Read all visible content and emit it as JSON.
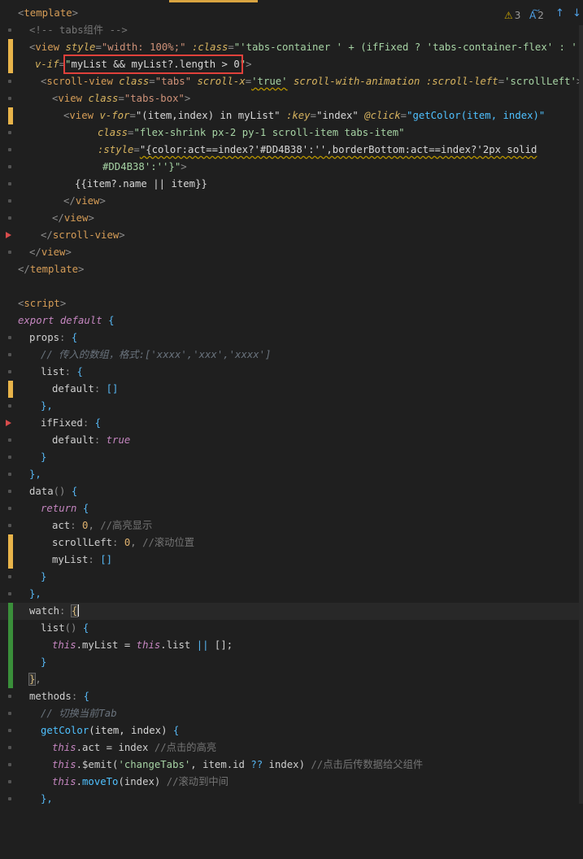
{
  "header": {
    "warning_count": "3",
    "info_count": "2"
  },
  "icons": [
    "warning-icon",
    "spell-icon",
    "arrow-up-icon",
    "arrow-down-icon"
  ],
  "colors": {
    "background": "#1f1f1f",
    "modified_marker": "#e8b44a",
    "added_marker": "#3a8f3a",
    "highlight_box": "#e0413b"
  },
  "code": {
    "l1": {
      "t1": "<",
      "t2": "template",
      "t3": ">"
    },
    "l2": {
      "t1": "<!-- tabs组件 -->"
    },
    "l3": {
      "t1": "<",
      "t2": "view",
      "t3": " ",
      "t4": "style",
      "t5": "=",
      "t6": "\"width: 100%;\"",
      "t7": " ",
      "t8": ":class",
      "t9": "=",
      "t10": "\"'tabs-container ' + (ifFixed ? 'tabs-container-flex' : '')\""
    },
    "l4": {
      "t1": "v-if",
      "t2": "=",
      "t3": "\"",
      "t4": "myList && myList?.length > 0",
      "t5": "\"",
      "t6": ">"
    },
    "l5": {
      "t1": "<",
      "t2": "scroll-view",
      "t3": " ",
      "t4": "class",
      "t5": "=",
      "t6": "\"tabs\"",
      "t7": " ",
      "t8": "scroll-x",
      "t9": "=",
      "t10": "'true'",
      "t11": " ",
      "t12": "scroll-with-animation",
      "t13": " ",
      "t14": ":scroll-left",
      "t15": "=",
      "t16": "'scrollLeft'",
      "t17": ">"
    },
    "l6": {
      "t1": "<",
      "t2": "view",
      "t3": " ",
      "t4": "class",
      "t5": "=",
      "t6": "\"tabs-box\"",
      "t7": ">"
    },
    "l7": {
      "t1": "<",
      "t2": "view",
      "t3": " ",
      "t4": "v-for",
      "t5": "=",
      "t6": "\"(item,index) in myList\"",
      "t7": " ",
      "t8": ":key",
      "t9": "=",
      "t10": "\"index\"",
      "t11": " ",
      "t12": "@click",
      "t13": "=",
      "t14": "\"getColor(item, index)\""
    },
    "l8": {
      "t1": "class",
      "t2": "=",
      "t3": "\"flex-shrink px-2 py-1 scroll-item tabs-item\""
    },
    "l9": {
      "t1": ":style",
      "t2": "=",
      "t3": "\"{color:act==index?'#DD4B38':'',borderBottom:act==index?'2px solid"
    },
    "l10": {
      "t1": "#DD4B38':''}\"",
      "t2": ">"
    },
    "l11": {
      "t1": "{{item?.name || item}}"
    },
    "l12": {
      "t1": "</",
      "t2": "view",
      "t3": ">"
    },
    "l13": {
      "t1": "</",
      "t2": "view",
      "t3": ">"
    },
    "l14": {
      "t1": "</",
      "t2": "scroll-view",
      "t3": ">"
    },
    "l15": {
      "t1": "</",
      "t2": "view",
      "t3": ">"
    },
    "l16": {
      "t1": "</",
      "t2": "template",
      "t3": ">"
    },
    "l18": {
      "t1": "<",
      "t2": "script",
      "t3": ">"
    },
    "l19": {
      "t1": "export default",
      "t2": " ",
      "t3": "{"
    },
    "l20": {
      "t1": "props",
      "t2": ": ",
      "t3": "{"
    },
    "l21": {
      "t1": "// 传入的数组，格式:['xxxx','xxx','xxxx']"
    },
    "l22": {
      "t1": "list",
      "t2": ": ",
      "t3": "{"
    },
    "l23": {
      "t1": "default",
      "t2": ": ",
      "t3": "[]"
    },
    "l24": {
      "t1": "},"
    },
    "l25": {
      "t1": "ifFixed",
      "t2": ": ",
      "t3": "{"
    },
    "l26": {
      "t1": "default",
      "t2": ": ",
      "t3": "true"
    },
    "l27": {
      "t1": "}"
    },
    "l28": {
      "t1": "},"
    },
    "l29": {
      "t1": "data",
      "t2": "() ",
      "t3": "{"
    },
    "l30": {
      "t1": "return",
      "t2": " ",
      "t3": "{"
    },
    "l31": {
      "t1": "act",
      "t2": ": ",
      "t3": "0",
      "t4": ", ",
      "t5": "//高亮显示"
    },
    "l32": {
      "t1": "scrollLeft",
      "t2": ": ",
      "t3": "0",
      "t4": ", ",
      "t5": "//滚动位置"
    },
    "l33": {
      "t1": "myList",
      "t2": ": ",
      "t3": "[]"
    },
    "l34": {
      "t1": "}"
    },
    "l35": {
      "t1": "},"
    },
    "l36": {
      "t1": "watch",
      "t2": ": ",
      "t3": "{"
    },
    "l37": {
      "t1": "list",
      "t2": "() ",
      "t3": "{"
    },
    "l38": {
      "t1": "this",
      "t2": ".myList = ",
      "t3": "this",
      "t4": ".list ",
      "t5": "||",
      "t6": " [];"
    },
    "l39": {
      "t1": "}"
    },
    "l40": {
      "t1": "}",
      "t2": ","
    },
    "l41": {
      "t1": "methods",
      "t2": ": ",
      "t3": "{"
    },
    "l42": {
      "t1": "// 切换当前Tab"
    },
    "l43": {
      "t1": "getColor",
      "t2": "(item, index) ",
      "t3": "{"
    },
    "l44": {
      "t1": "this",
      "t2": ".act = index ",
      "t3": "//点击的高亮"
    },
    "l45": {
      "t1": "this",
      "t2": ".$emit(",
      "t3": "'changeTabs'",
      "t4": ", item.id ",
      "t5": "??",
      "t6": " index) ",
      "t7": "//点击后传数据给父组件"
    },
    "l46": {
      "t1": "this",
      "t2": ".",
      "t3": "moveTo",
      "t4": "(index) ",
      "t5": "//滚动到中间"
    },
    "l47": {
      "t1": "},"
    }
  }
}
